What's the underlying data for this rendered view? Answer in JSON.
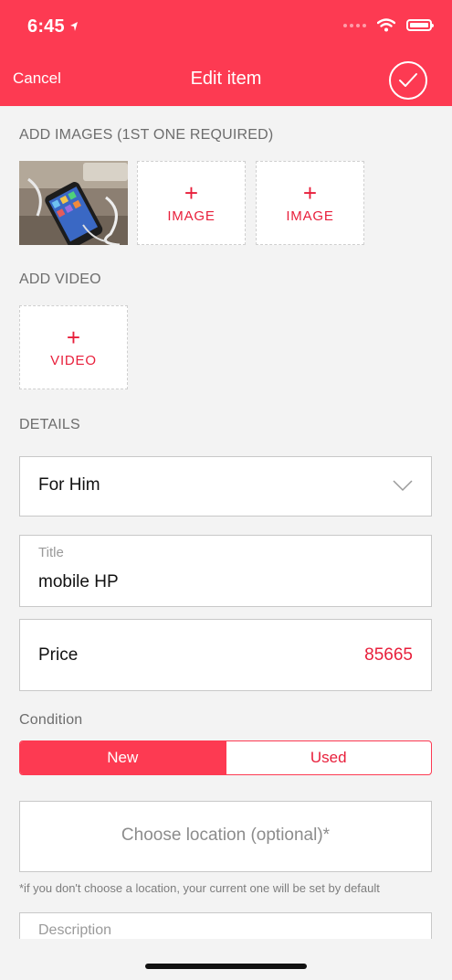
{
  "status": {
    "time": "6:45"
  },
  "nav": {
    "cancel": "Cancel",
    "title": "Edit item"
  },
  "images": {
    "section_label": "ADD IMAGES (1ST ONE REQUIRED)",
    "slots": [
      {
        "plus": "+",
        "label": "IMAGE"
      },
      {
        "plus": "+",
        "label": "IMAGE"
      }
    ]
  },
  "video": {
    "section_label": "ADD VIDEO",
    "plus": "+",
    "label": "VIDEO"
  },
  "details": {
    "section_label": "DETAILS",
    "category": "For Him",
    "title_label": "Title",
    "title_value": "mobile HP",
    "price_label": "Price",
    "price_value": "85665",
    "condition_label": "Condition",
    "condition_options": [
      "New",
      "Used"
    ],
    "condition_selected": "New",
    "location_placeholder": "Choose location (optional)*",
    "location_hint": "*if you don't choose a location, your current one will be set by default",
    "description_label": "Description"
  },
  "colors": {
    "accent": "#fd3a52",
    "accent_text": "#e81f3b",
    "background": "#f3f3f3"
  }
}
